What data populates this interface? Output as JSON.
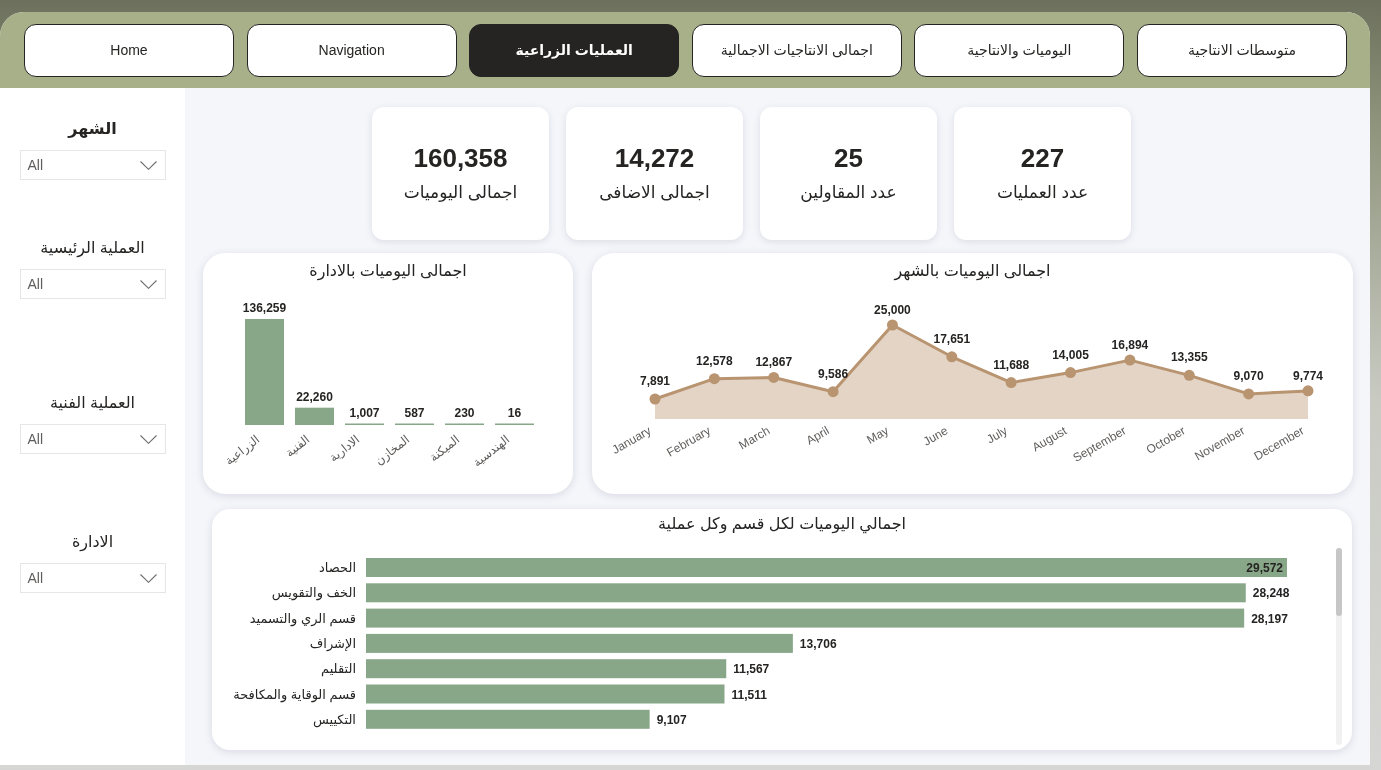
{
  "nav_tabs": [
    {
      "label": "متوسطات الانتاجية",
      "selected": false
    },
    {
      "label": "اليوميات والانتاجية",
      "selected": false
    },
    {
      "label": "اجمالى الانتاجيات الاجمالية",
      "selected": false
    },
    {
      "label": "العمليات الزراعية",
      "selected": true
    },
    {
      "label": "Navigation",
      "selected": false
    },
    {
      "label": "Home",
      "selected": false
    }
  ],
  "filters": [
    {
      "label": "الشهر",
      "value": "All"
    },
    {
      "label": "العملية الرئيسية",
      "value": "All"
    },
    {
      "label": "العملية الفنية",
      "value": "All"
    },
    {
      "label": "الادارة",
      "value": "All"
    }
  ],
  "kpis": [
    {
      "value": "227",
      "label": "عدد العمليات"
    },
    {
      "value": "25",
      "label": "عدد المقاولين"
    },
    {
      "value": "14,272",
      "label": "اجمالى الاضافى"
    },
    {
      "value": "160,358",
      "label": "اجمالى اليوميات"
    }
  ],
  "charts": [
    {
      "chart_data": {
        "type": "bar",
        "title": "اجمالى اليوميات بالادارة",
        "categories": [
          "الزراعية",
          "الفنية",
          "الادارية",
          "المخازن",
          "الميكنة",
          "الهندسية"
        ],
        "values": [
          136259,
          22260,
          1007,
          587,
          230,
          16
        ],
        "color": "#88a788",
        "value_labels": [
          "136,259",
          "22,260",
          "1,007",
          "587",
          "230",
          "16"
        ]
      }
    },
    {
      "chart_data": {
        "type": "area",
        "title": "اجمالى اليوميات بالشهر",
        "categories": [
          "January",
          "February",
          "March",
          "April",
          "May",
          "June",
          "July",
          "August",
          "September",
          "October",
          "November",
          "December"
        ],
        "values": [
          7891,
          12578,
          12867,
          9586,
          25000,
          17651,
          11688,
          14005,
          16894,
          13355,
          9070,
          9774
        ],
        "color": "#b99470",
        "marker": "circle",
        "value_labels": [
          "7,891",
          "12,578",
          "12,867",
          "9,586",
          "25,000",
          "17,651",
          "11,688",
          "14,005",
          "16,894",
          "13,355",
          "9,070",
          "9,774"
        ]
      }
    },
    {
      "chart_data": {
        "type": "bar",
        "orientation": "horizontal",
        "title": "اجمالي اليوميات لكل قسم وكل عملية",
        "categories": [
          "الحصاد",
          "الخف والتقويس",
          "قسم الري والتسميد",
          "الإشراف",
          "التقليم",
          "قسم الوقاية والمكافحة",
          "التكييس"
        ],
        "values": [
          29572,
          28248,
          28197,
          13706,
          11567,
          11511,
          9107
        ],
        "color": "#88a788",
        "value_labels": [
          "29,572",
          "28,248",
          "28,197",
          "13,706",
          "11,567",
          "11,511",
          "9,107"
        ]
      }
    }
  ]
}
